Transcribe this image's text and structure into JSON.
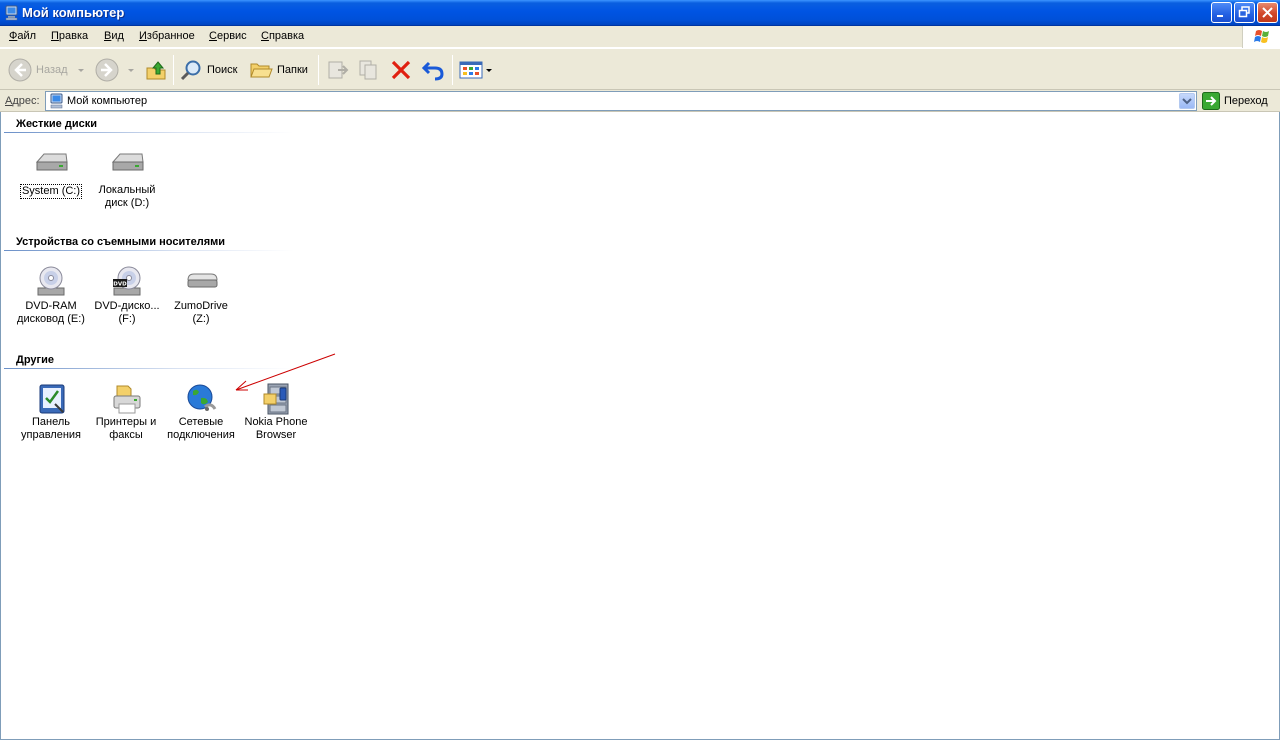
{
  "window": {
    "title": "Мой компьютер"
  },
  "menu": [
    {
      "ul": "Ф",
      "rest": "айл"
    },
    {
      "ul": "П",
      "rest": "равка"
    },
    {
      "ul": "В",
      "rest": "ид"
    },
    {
      "ul": "И",
      "rest": "збранное"
    },
    {
      "ul": "С",
      "rest": "ервис"
    },
    {
      "ul": "С",
      "rest": "правка"
    }
  ],
  "toolbar": {
    "back_label": "Назад",
    "search_label": "Поиск",
    "folders_label": "Папки"
  },
  "address": {
    "label_ul": "А",
    "label_rest": "дрес:",
    "value": "Мой компьютер",
    "go_label": "Переход"
  },
  "groups": {
    "hard_disks": {
      "title": "Жесткие диски",
      "items": [
        {
          "name": "System (C:)",
          "icon": "hard-drive-icon"
        },
        {
          "name": "Локальный диск (D:)",
          "icon": "hard-drive-icon"
        }
      ]
    },
    "removable": {
      "title": "Устройства со съемными носителями",
      "items": [
        {
          "name": "DVD-RAM дисковод (E:)",
          "icon": "dvd-drive-icon"
        },
        {
          "name": "DVD-диско... (F:)",
          "icon": "dvd-drive-icon"
        },
        {
          "name": "ZumoDrive (Z:)",
          "icon": "removable-drive-icon"
        }
      ]
    },
    "other": {
      "title": "Другие",
      "items": [
        {
          "name": "Панель управления",
          "icon": "control-panel-icon"
        },
        {
          "name": "Принтеры и факсы",
          "icon": "printer-icon"
        },
        {
          "name": "Сетевые подключения",
          "icon": "network-connections-icon"
        },
        {
          "name": "Nokia Phone Browser",
          "icon": "nokia-phone-browser-icon"
        }
      ]
    }
  },
  "colors": {
    "titlebar": "#0054e3",
    "chrome": "#ece9d8",
    "annotation_arrow": "#cc0000"
  }
}
